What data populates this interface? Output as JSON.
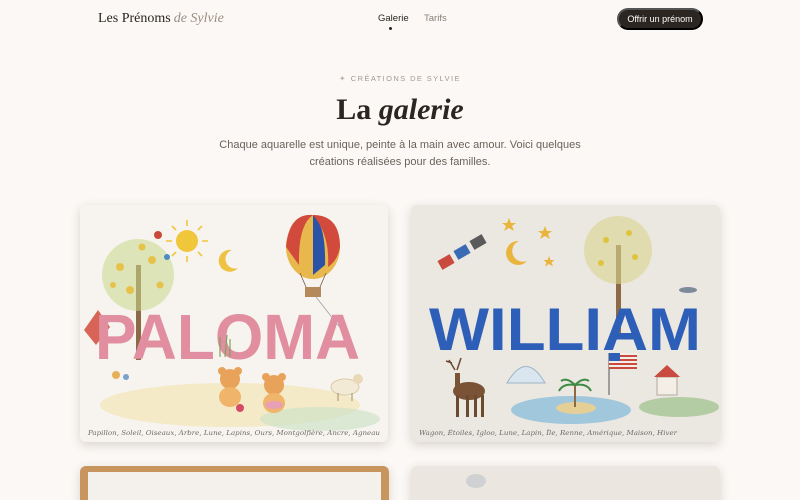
{
  "nav": {
    "brand": "Les Prénoms",
    "brand_sub": "de Sylvie",
    "links": [
      "Galerie",
      "Tarifs"
    ],
    "active_link": "Galerie",
    "cta_label": "Offrir un prénom"
  },
  "hero": {
    "eyebrow": "CRÉATIONS DE SYLVIE",
    "eyebrow_icon": "sparkle-icon",
    "title_plain": "La",
    "title_italic": "galerie",
    "intro": "Chaque aquarelle est unique, peinte à la main avec amour. Voici quelques créations réalisées pour des familles."
  },
  "gallery": [
    {
      "name": "PALOMA",
      "caption": "Papillon, Soleil, Oiseaux, Arbre, Lune, Lapins, Ours, Montgolfière, Ancre, Agneau",
      "letter_color": "#e08ea0"
    },
    {
      "name": "WILLIAM",
      "caption": "Wagon, Étoiles, Igloo, Lune, Lapin, Île, Renne, Amérique, Maison, Hiver",
      "letter_color": "#2e5fb8"
    },
    {
      "name": "",
      "caption": ""
    },
    {
      "name": "",
      "caption": ""
    }
  ],
  "colors": {
    "background": "#fbf8f5",
    "ink": "#2b2622",
    "muted": "#8a8079"
  }
}
